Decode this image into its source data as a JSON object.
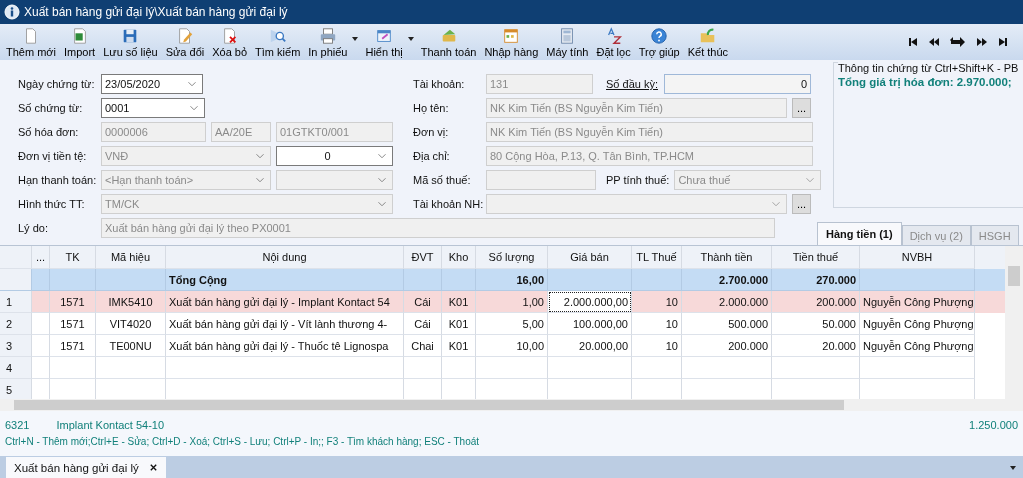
{
  "window": {
    "title": "Xuất bán hàng gửi đại lý\\Xuất bán hàng gửi đại lý"
  },
  "toolbar": [
    {
      "label": "Thêm mới",
      "dropdown": false
    },
    {
      "label": "Import",
      "dropdown": false
    },
    {
      "label": "Lưu số liệu",
      "dropdown": false
    },
    {
      "label": "Sửa đổi",
      "dropdown": false
    },
    {
      "label": "Xóa bỏ",
      "dropdown": false
    },
    {
      "label": "Tìm kiếm",
      "dropdown": false
    },
    {
      "label": "In phiếu",
      "dropdown": true
    },
    {
      "label": "Hiển thị",
      "dropdown": true
    },
    {
      "label": "Thanh toán",
      "dropdown": false
    },
    {
      "label": "Nhập hàng",
      "dropdown": false
    },
    {
      "label": "Máy tính",
      "dropdown": false
    },
    {
      "label": "Đặt lọc",
      "dropdown": false
    },
    {
      "label": "Trợ giúp",
      "dropdown": false
    },
    {
      "label": "Kết thúc",
      "dropdown": false
    }
  ],
  "left_form": [
    {
      "label": "Ngày chứng từ:",
      "items": [
        {
          "kind": "combo",
          "value": "23/05/2020",
          "disabled": false
        }
      ]
    },
    {
      "label": "Số chứng từ:",
      "items": [
        {
          "kind": "combo",
          "value": "0001",
          "disabled": false
        }
      ]
    },
    {
      "label": "Số hóa đơn:",
      "items": [
        {
          "kind": "text",
          "value": "0000006",
          "disabled": true
        },
        {
          "kind": "text",
          "value": "AA/20E",
          "disabled": true
        },
        {
          "kind": "text",
          "value": "01GTKT0/001",
          "disabled": true
        }
      ]
    },
    {
      "label": "Đơn vị tiền tệ:",
      "items": [
        {
          "kind": "combo",
          "value": "VNĐ",
          "disabled": true
        },
        {
          "kind": "number",
          "value": "0",
          "disabled": false
        }
      ]
    },
    {
      "label": "Hạn thanh toán:",
      "items": [
        {
          "kind": "combo",
          "value": "<Hạn thanh toán>",
          "disabled": true
        },
        {
          "kind": "combo",
          "disabled": true
        }
      ]
    },
    {
      "label": "Hình thức TT:",
      "items": [
        {
          "kind": "combo",
          "value": "TM/CK",
          "disabled": true
        }
      ]
    }
  ],
  "right_form": [
    {
      "label": "Tài khoản:",
      "items": [
        {
          "kind": "text",
          "value": "131",
          "disabled": true
        },
        {
          "kind": "link",
          "value": "Số đầu kỳ:"
        },
        {
          "kind": "amount",
          "value": "0",
          "disabled": false
        }
      ]
    },
    {
      "label": "Họ tên:",
      "items": [
        {
          "kind": "text",
          "value": "NK Kim Tiến (BS Nguyễn Kim Tiến)",
          "disabled": true
        },
        {
          "kind": "button",
          "value": "..."
        }
      ]
    },
    {
      "label": "Đơn vị:",
      "items": [
        {
          "kind": "text",
          "value": "NK Kim Tiến (BS Nguyễn Kim Tiến)",
          "disabled": true
        }
      ]
    },
    {
      "label": "Địa chỉ:",
      "items": [
        {
          "kind": "text",
          "value": "80 Cộng Hòa, P.13, Q. Tân Bình, TP.HCM",
          "disabled": true
        }
      ]
    },
    {
      "label": "Mã số thuế:",
      "items": [
        {
          "kind": "text",
          "disabled": true
        },
        {
          "kind": "label",
          "value": "PP tính thuế:"
        },
        {
          "kind": "combo",
          "value": "Chưa thuế",
          "disabled": true
        }
      ]
    },
    {
      "label": "Tài khoản NH:",
      "items": [
        {
          "kind": "combo",
          "disabled": true
        },
        {
          "kind": "button",
          "value": "..."
        }
      ]
    }
  ],
  "reason": {
    "label": "Lý do:",
    "value": "Xuất bán hàng gửi đại lý theo PX0001",
    "disabled": true
  },
  "info_panel": {
    "title": "Thông tin chứng từ Ctrl+Shift+K - PB",
    "text": "Tổng giá trị hóa đơn: 2.970.000;"
  },
  "tabs": [
    {
      "label": "Hàng tiền (1)",
      "selected": true
    },
    {
      "label": "Dịch vụ (2)",
      "selected": false
    },
    {
      "label": "HSGH",
      "selected": false
    }
  ],
  "table": {
    "columns": [
      "...",
      "TK",
      "Mã hiệu",
      "Nội dung",
      "ĐVT",
      "Kho",
      "Số lượng",
      "Giá bán",
      "TL Thuế",
      "Thành tiền",
      "Tiền thuế",
      "NVBH"
    ],
    "total": {
      "label": "Tổng Cộng",
      "quantity": "16,00",
      "amount": "2.700.000",
      "tax": "270.000"
    },
    "rows": [
      {
        "number": "1",
        "selected": true,
        "cells": [
          "1571",
          "IMK5410",
          "Xuất bán hàng gửi đại lý - Implant Kontact 54",
          "Cái",
          "K01",
          "1,00",
          "2.000.000,00",
          "10",
          "2.000.000",
          "200.000",
          "Nguyễn Công Phượng"
        ]
      },
      {
        "number": "2",
        "selected": false,
        "cells": [
          "1571",
          "VIT4020",
          "Xuất bán hàng gửi đại lý - Vít lành thương 4-",
          "Cái",
          "K01",
          "5,00",
          "100.000,00",
          "10",
          "500.000",
          "50.000",
          "Nguyễn Công Phượng"
        ]
      },
      {
        "number": "3",
        "selected": false,
        "cells": [
          "1571",
          "TE00NU",
          "Xuất bán hàng gửi đại lý - Thuốc tê Lignospa",
          "Chai",
          "K01",
          "10,00",
          "20.000,00",
          "10",
          "200.000",
          "20.000",
          "Nguyễn Công Phượng"
        ]
      },
      {
        "number": "4",
        "selected": false
      },
      {
        "number": "5",
        "selected": false
      }
    ]
  },
  "status": {
    "account": "6321",
    "item": "Implant Kontact 54-10",
    "value": "1.250.000",
    "shortcuts": "Ctrl+N - Thêm mới;Ctrl+E - Sửa; Ctrl+D - Xoá; Ctrl+S - Lưu; Ctrl+P - In;; F3 - Tìm khách hàng; ESC - Thoát"
  },
  "document_tabs": [
    {
      "label": "Xuất bán hàng gửi đại lý",
      "selected": true
    }
  ]
}
